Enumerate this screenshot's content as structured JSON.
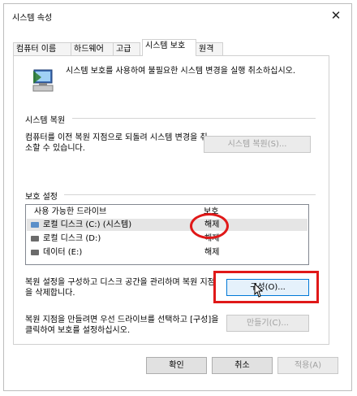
{
  "window": {
    "title": "시스템 속성",
    "close_glyph": "✕"
  },
  "tabs": [
    {
      "label": "컴퓨터 이름"
    },
    {
      "label": "하드웨어"
    },
    {
      "label": "고급"
    },
    {
      "label": "시스템 보호",
      "active": true
    },
    {
      "label": "원격"
    }
  ],
  "intro_text": "시스템 보호를 사용하여 불필요한 시스템 변경을 실행 취소하십시오.",
  "restore": {
    "heading": "시스템 복원",
    "description": "컴퓨터를 이전 복원 지점으로 되돌려 시스템 변경을 취소할 수 있습니다.",
    "button_label": "시스템 복원(S)..."
  },
  "protection": {
    "heading": "보호 설정",
    "columns": {
      "drive": "사용 가능한 드라이브",
      "status": "보호"
    },
    "drives": [
      {
        "name": "로컬 디스크 (C:) (시스템)",
        "status": "해제",
        "icon": "windows-drive-icon",
        "selected": true
      },
      {
        "name": "로컬 디스크 (D:)",
        "status": "해제",
        "icon": "drive-icon"
      },
      {
        "name": "데이터 (E:)",
        "status": "해제",
        "icon": "drive-icon"
      }
    ],
    "configure_text": "복원 설정을 구성하고 디스크 공간을 관리하며 복원 지점을 삭제합니다.",
    "configure_button": "구성(O)...",
    "create_text": "복원 지점을 만들려면 우선 드라이브를 선택하고 [구성]을 클릭하여 보호를 설정하십시오.",
    "create_button": "만들기(C)..."
  },
  "footer": {
    "ok": "확인",
    "cancel": "취소",
    "apply": "적용(A)"
  },
  "colors": {
    "highlight": "#e01818",
    "focus": "#0078d7"
  }
}
